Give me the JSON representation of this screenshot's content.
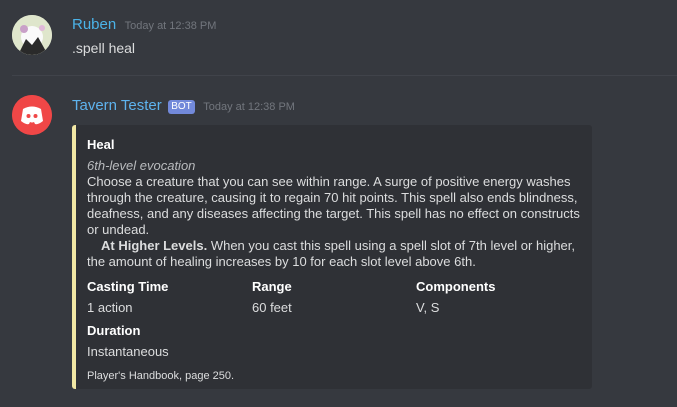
{
  "messages": [
    {
      "author": "Ruben",
      "author_color": "#4bb3e8",
      "timestamp": "Today at 12:38 PM",
      "text": ".spell heal"
    },
    {
      "author": "Tavern Tester",
      "author_color": "#5eb3ee",
      "bot_tag": "BOT",
      "timestamp": "Today at 12:38 PM"
    }
  ],
  "embed": {
    "accent_color": "#f1e7a4",
    "title": "Heal",
    "subtitle": "6th-level evocation",
    "description": "Choose a creature that you can see within range. A surge of positive energy washes through the creature, causing it to regain 70 hit points. This spell also ends blindness, deafness, and any diseases affecting the target. This spell has no effect on constructs or undead.",
    "higher_levels_label": "At Higher Levels.",
    "higher_levels_text": " When you cast this spell using a spell slot of 7th level or higher, the amount of healing increases by 10 for each slot level above 6th.",
    "fields": [
      {
        "name": "Casting Time",
        "value": "1 action"
      },
      {
        "name": "Range",
        "value": "60 feet"
      },
      {
        "name": "Components",
        "value": "V, S"
      },
      {
        "name": "Duration",
        "value": "Instantaneous"
      }
    ],
    "footer": "Player's Handbook, page 250."
  }
}
